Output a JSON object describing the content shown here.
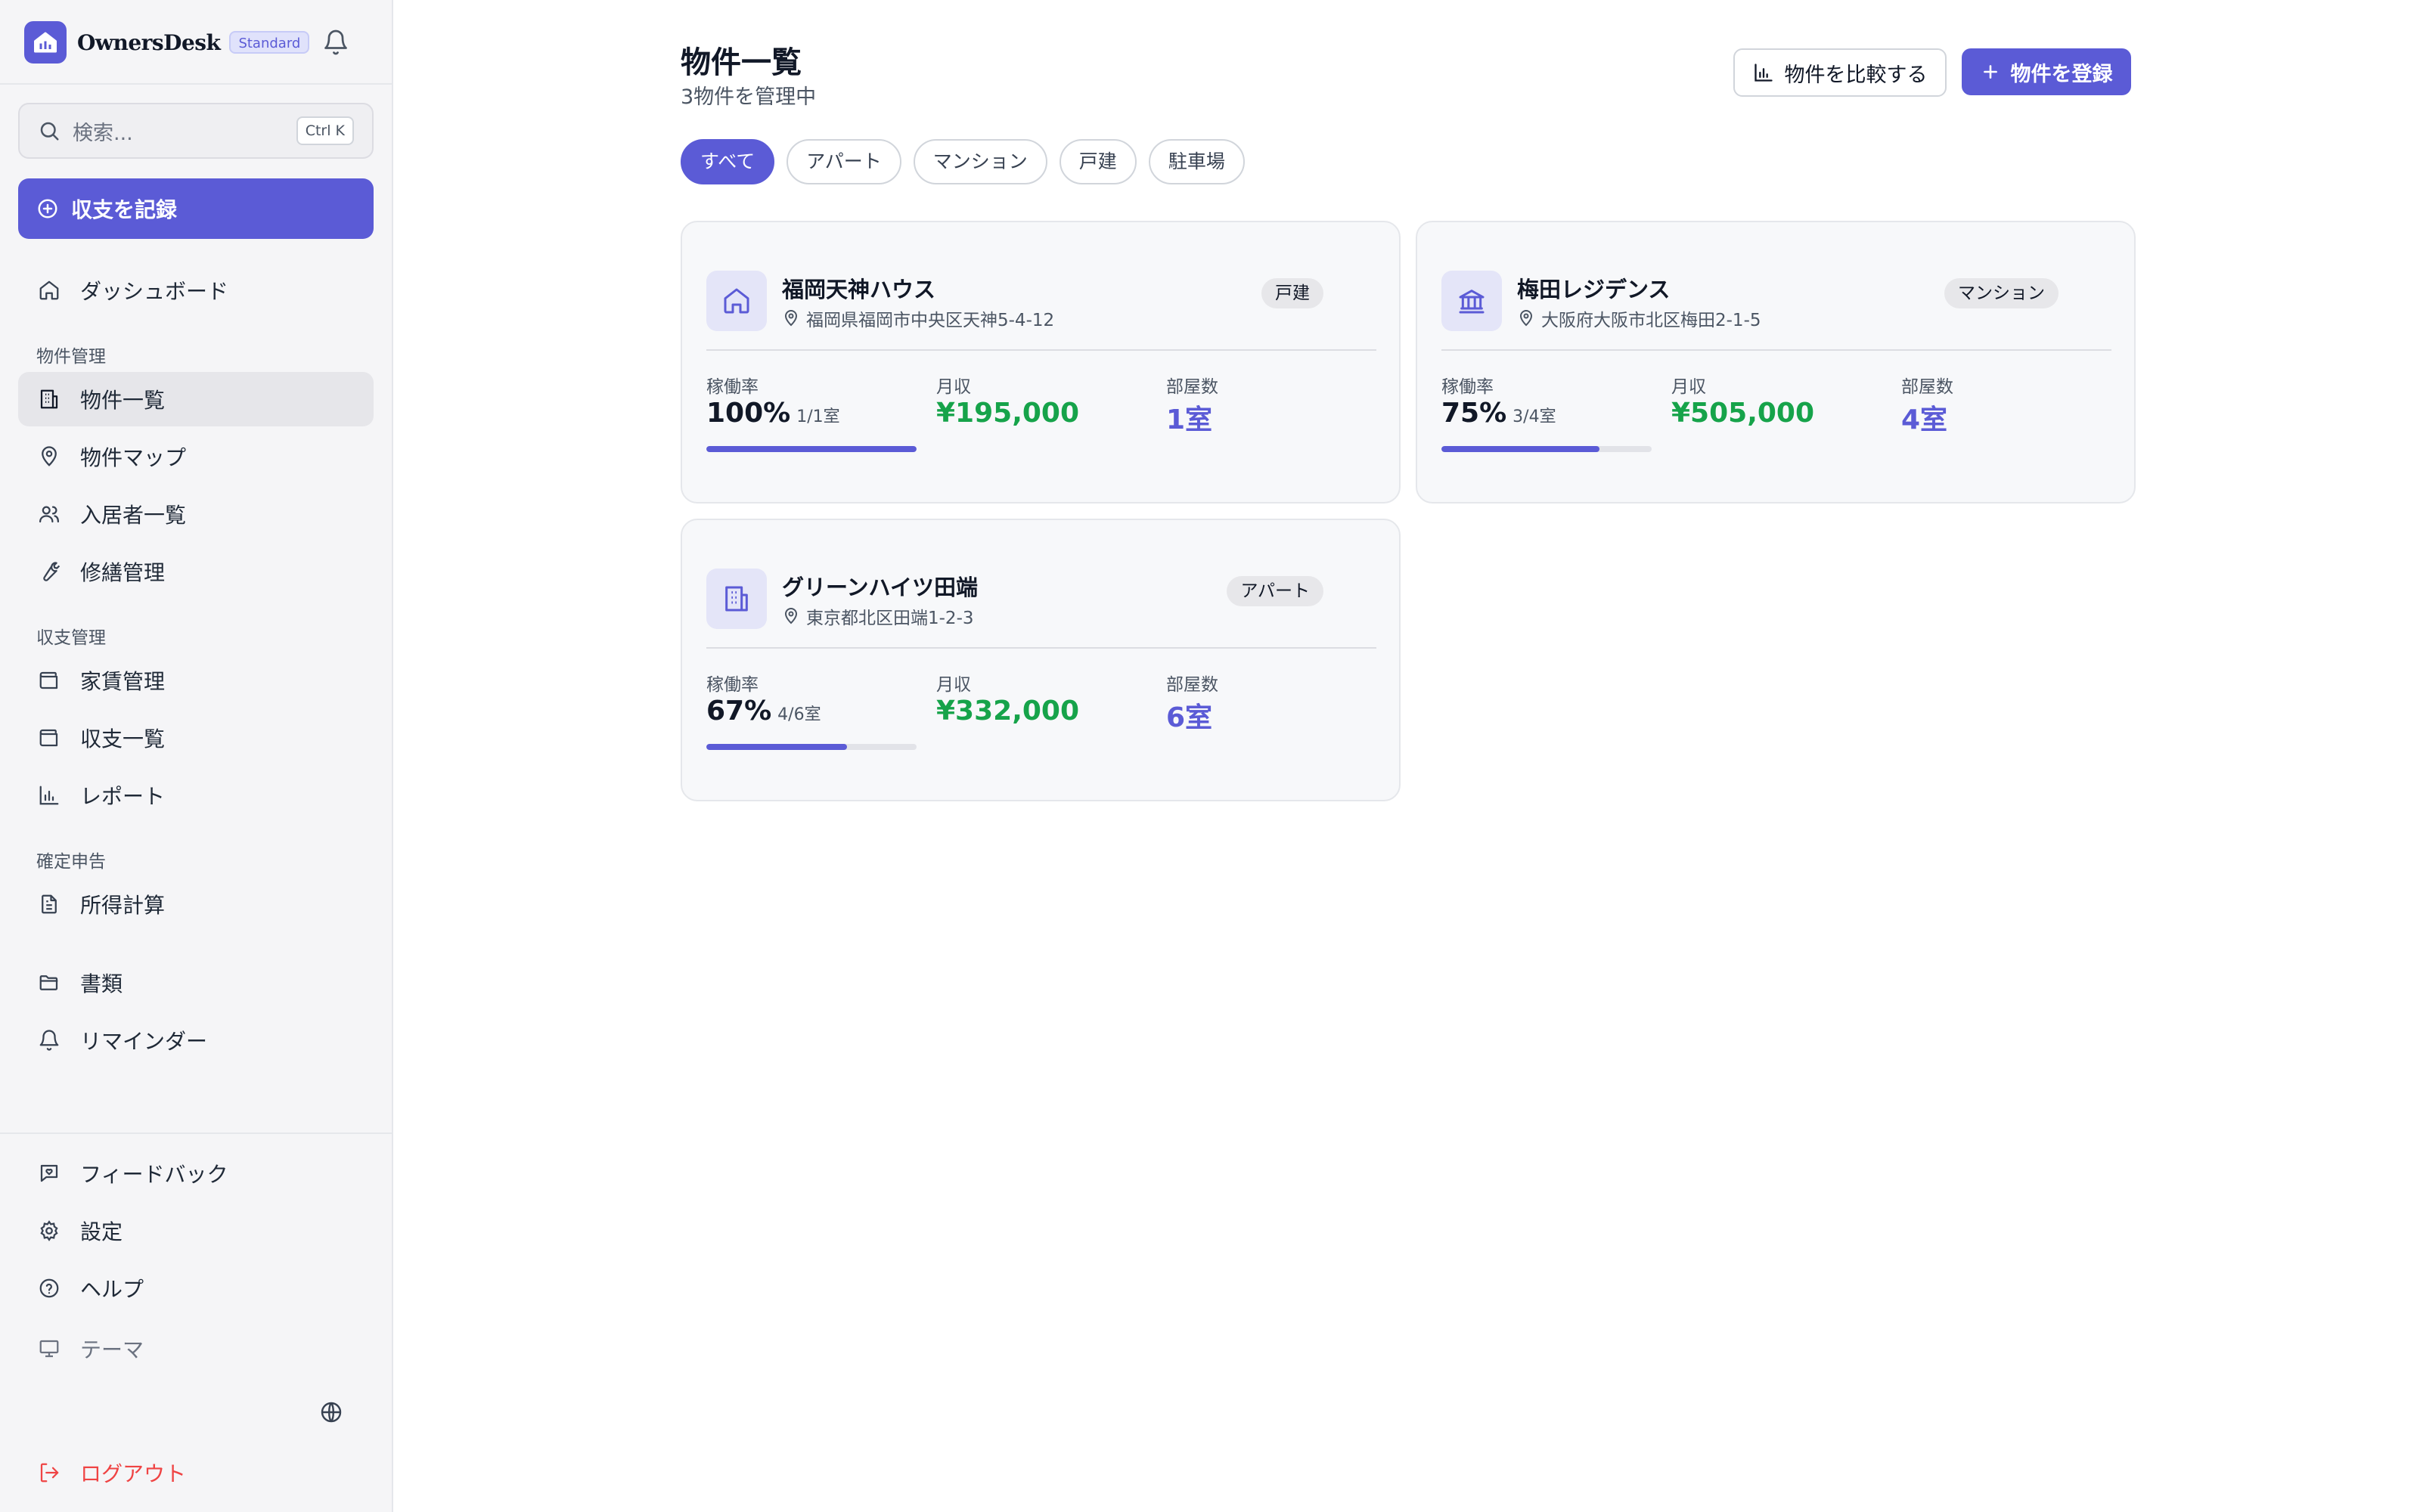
{
  "brand": {
    "name": "OwnersDesk",
    "plan": "Standard"
  },
  "search": {
    "placeholder": "検索...",
    "shortcut": "Ctrl K"
  },
  "sidebar": {
    "record_button": "収支を記録",
    "dashboard": "ダッシュボード",
    "sections": {
      "property": "物件管理",
      "finance": "収支管理",
      "tax": "確定申告"
    },
    "items": {
      "properties": "物件一覧",
      "map": "物件マップ",
      "tenants": "入居者一覧",
      "repairs": "修繕管理",
      "rent": "家賃管理",
      "ledger": "収支一覧",
      "reports": "レポート",
      "income_calc": "所得計算",
      "documents": "書類",
      "reminders": "リマインダー",
      "feedback": "フィードバック",
      "settings": "設定",
      "help": "ヘルプ",
      "theme": "テーマ",
      "logout": "ログアウト"
    }
  },
  "header": {
    "title": "物件一覧",
    "subtitle": "3物件を管理中",
    "compare_button": "物件を比較する",
    "add_button": "物件を登録"
  },
  "filters": [
    "すべて",
    "アパート",
    "マンション",
    "戸建",
    "駐車場"
  ],
  "labels": {
    "occupancy": "稼働率",
    "income": "月収",
    "rooms": "部屋数"
  },
  "properties": [
    {
      "name": "福岡天神ハウス",
      "address": "福岡県福岡市中央区天神5-4-12",
      "type": "戸建",
      "occupancy": "100%",
      "occupancy_detail": "1/1室",
      "occupancy_ratio": 1.0,
      "income": "¥195,000",
      "rooms": "1室",
      "icon": "house-icon"
    },
    {
      "name": "梅田レジデンス",
      "address": "大阪府大阪市北区梅田2-1-5",
      "type": "マンション",
      "occupancy": "75%",
      "occupancy_detail": "3/4室",
      "occupancy_ratio": 0.75,
      "income": "¥505,000",
      "rooms": "4室",
      "icon": "landmark-icon"
    },
    {
      "name": "グリーンハイツ田端",
      "address": "東京都北区田端1-2-3",
      "type": "アパート",
      "occupancy": "67%",
      "occupancy_detail": "4/6室",
      "occupancy_ratio": 0.67,
      "income": "¥332,000",
      "rooms": "6室",
      "icon": "building-icon"
    }
  ],
  "colors": {
    "accent": "#5b5bd6",
    "income": "#16a34a",
    "danger": "#ef4444"
  }
}
